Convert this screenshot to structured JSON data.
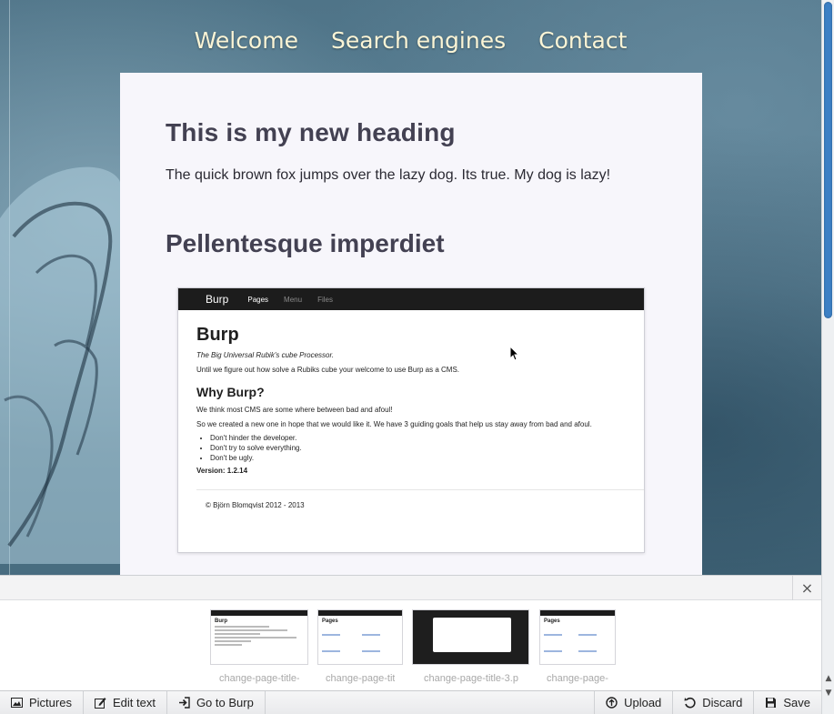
{
  "nav": {
    "items": [
      "Welcome",
      "Search engines",
      "Contact"
    ]
  },
  "content": {
    "heading1": "This is my new heading",
    "paragraph": "The quick brown fox jumps over the lazy dog. Its true. My dog is lazy!",
    "heading2": "Pellentesque imperdiet"
  },
  "screenshot": {
    "brand": "Burp",
    "nav": [
      "Pages",
      "Menu",
      "Files"
    ],
    "title": "Burp",
    "tagline": "The Big Universal Rubik's cube Processor.",
    "intro": "Until we figure out how solve a Rubiks cube your welcome to use Burp as a CMS.",
    "why_heading": "Why Burp?",
    "why_p1": "We think most CMS are some where between bad and afoul!",
    "why_p2": "So we created a new one in hope that we would like it. We have 3 guiding goals that help us stay away from bad and afoul.",
    "goals": [
      "Don't hinder the developer.",
      "Don't try to solve everything.",
      "Don't be ugly."
    ],
    "version": "Version: 1.2.14",
    "footer": "© Björn Blomqvist 2012 - 2013"
  },
  "pictures": {
    "close": "×",
    "thumbs": [
      {
        "label": "change-page-title-"
      },
      {
        "label": "change-page-tit"
      },
      {
        "label": "change-page-title-3.p"
      },
      {
        "label": "change-page-"
      }
    ]
  },
  "toolbar": {
    "pictures": "Pictures",
    "edit_text": "Edit text",
    "go_to_burp": "Go to Burp",
    "upload": "Upload",
    "discard": "Discard",
    "save": "Save"
  }
}
